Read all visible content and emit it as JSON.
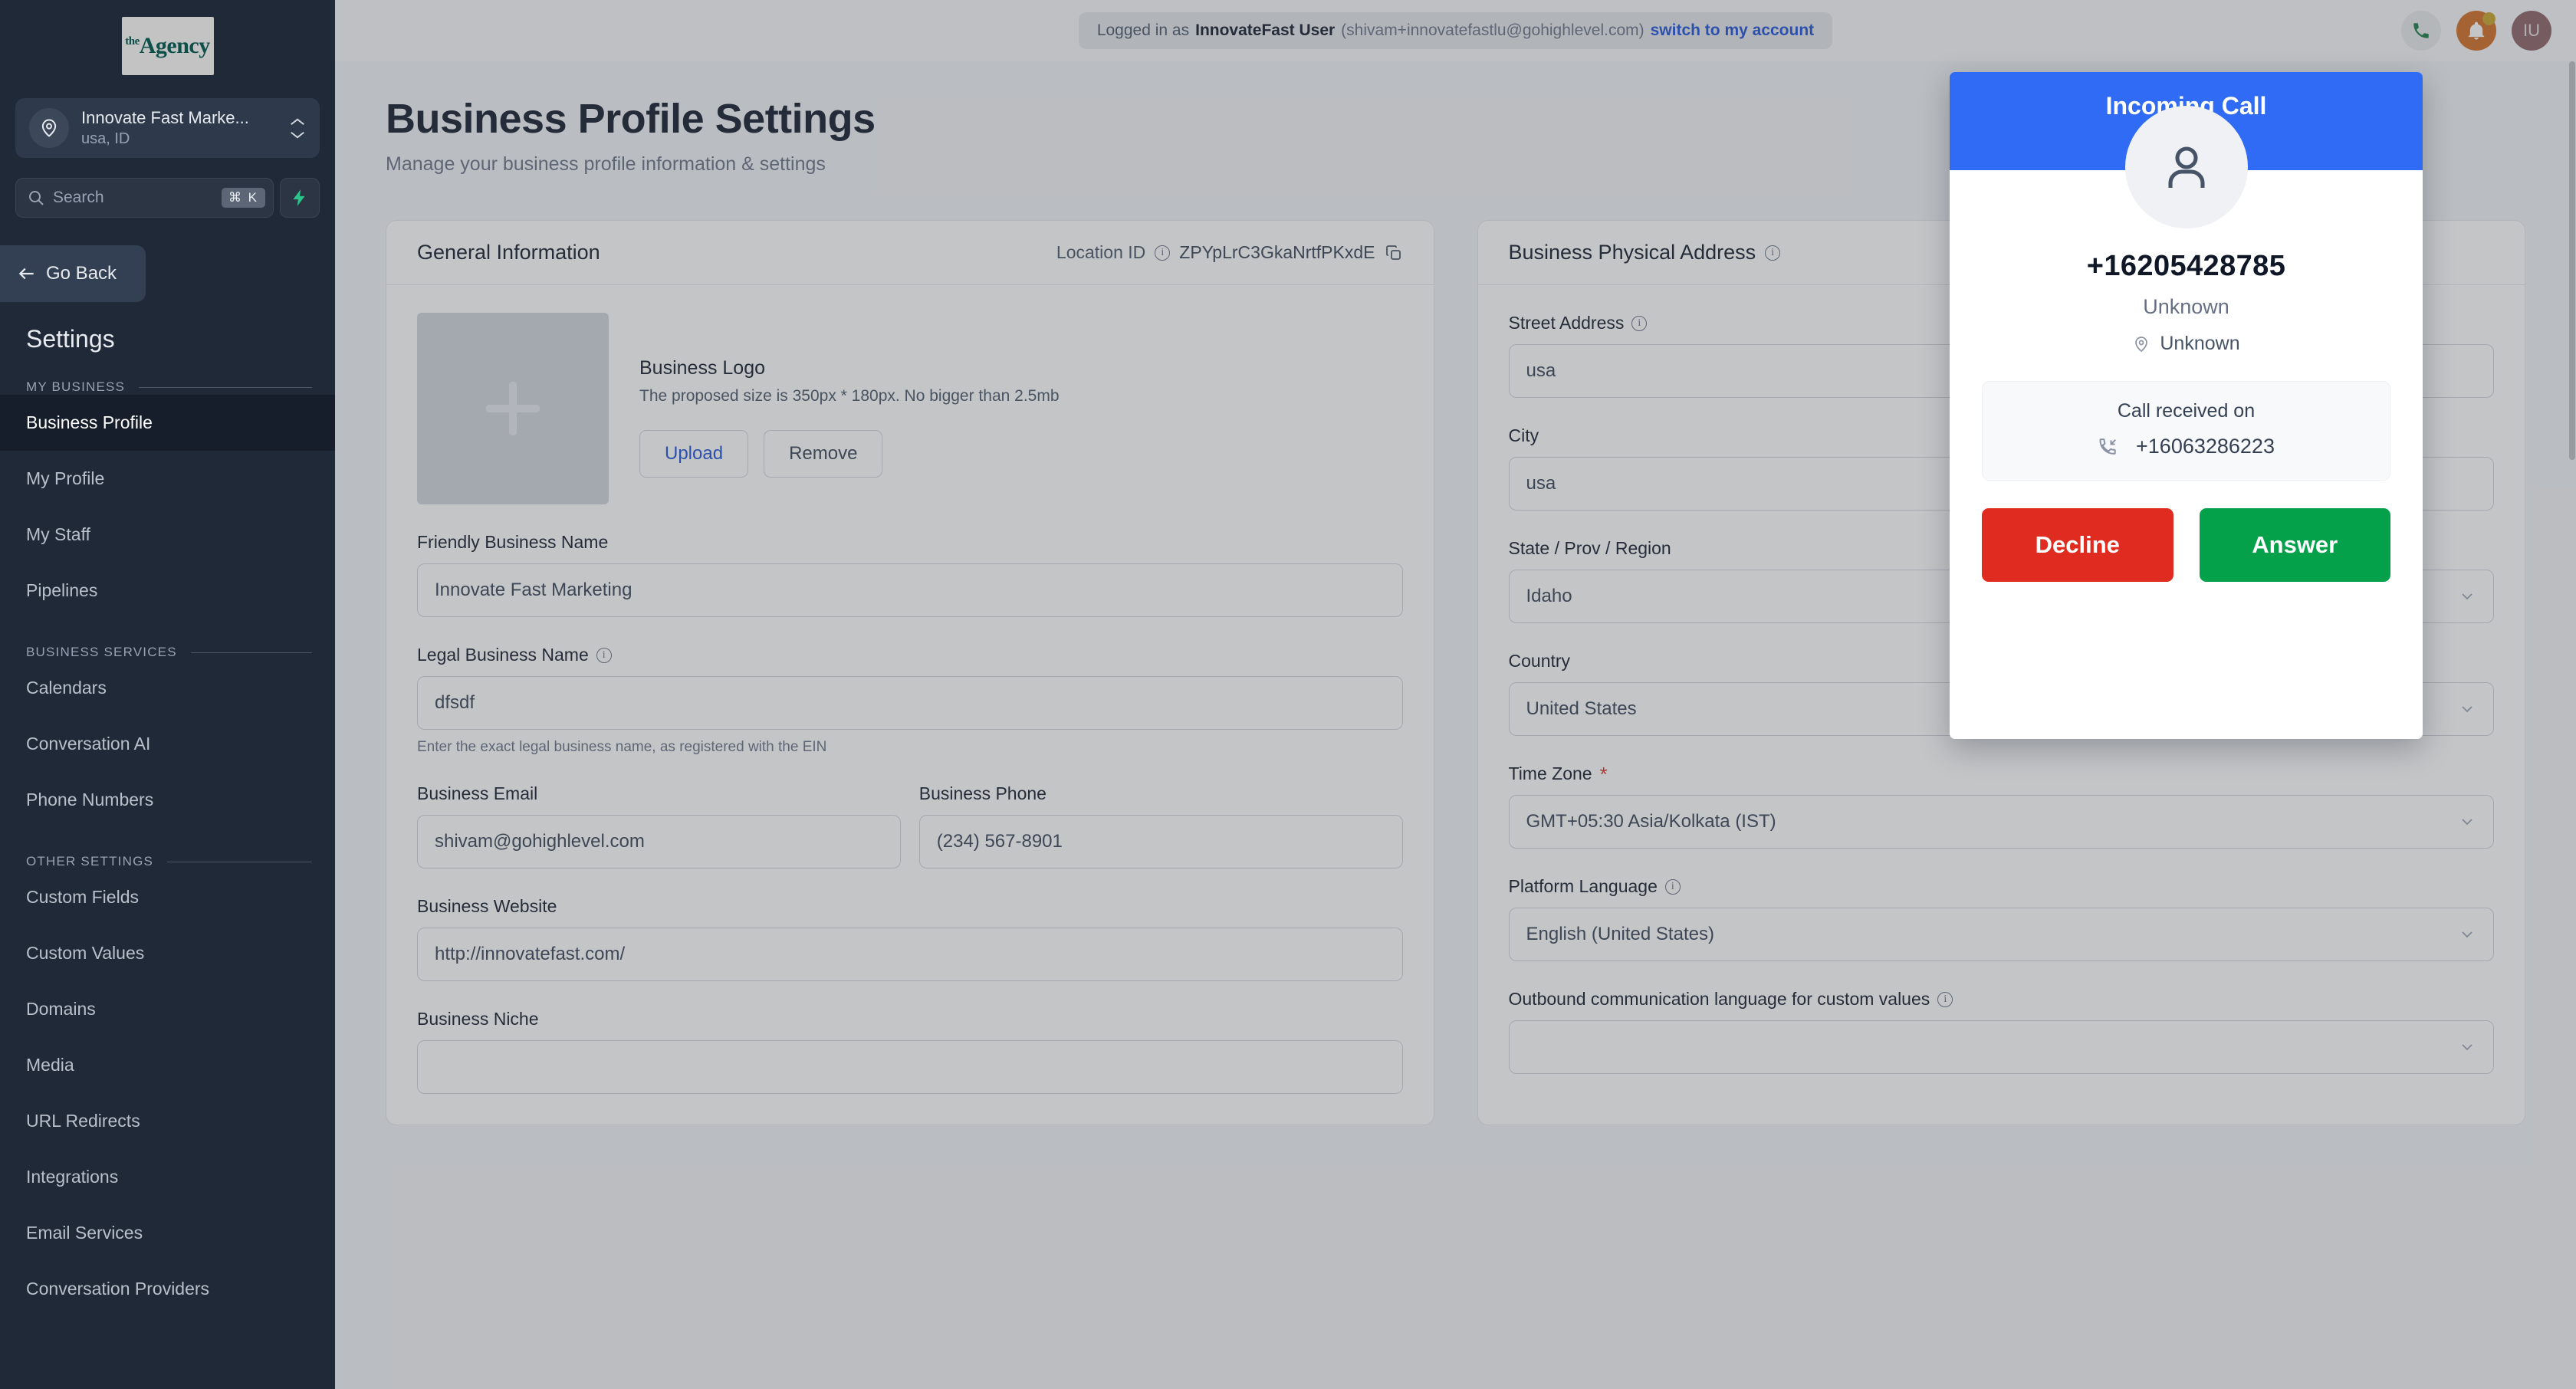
{
  "sidebar": {
    "logo": {
      "sup": "the",
      "name": "Agency"
    },
    "location": {
      "name": "Innovate Fast Marke...",
      "sub": "usa, ID"
    },
    "search": {
      "placeholder": "Search",
      "shortcut": "⌘ K"
    },
    "go_back": "Go Back",
    "title": "Settings",
    "sections": [
      {
        "label": "MY BUSINESS",
        "items": [
          {
            "label": "Business Profile",
            "active": true
          },
          {
            "label": "My Profile",
            "active": false
          },
          {
            "label": "My Staff",
            "active": false
          },
          {
            "label": "Pipelines",
            "active": false
          }
        ]
      },
      {
        "label": "BUSINESS SERVICES",
        "items": [
          {
            "label": "Calendars",
            "active": false
          },
          {
            "label": "Conversation AI",
            "active": false
          },
          {
            "label": "Phone Numbers",
            "active": false
          }
        ]
      },
      {
        "label": "OTHER SETTINGS",
        "items": [
          {
            "label": "Custom Fields",
            "active": false
          },
          {
            "label": "Custom Values",
            "active": false
          },
          {
            "label": "Domains",
            "active": false
          },
          {
            "label": "Media",
            "active": false
          },
          {
            "label": "URL Redirects",
            "active": false
          },
          {
            "label": "Integrations",
            "active": false
          },
          {
            "label": "Email Services",
            "active": false
          },
          {
            "label": "Conversation Providers",
            "active": false
          }
        ]
      }
    ]
  },
  "topbar": {
    "logged_in_prefix": "Logged in as",
    "user_name": "InnovateFast User",
    "user_email": "(shivam+innovatefastlu@gohighlevel.com)",
    "switch_link": "switch to my account",
    "avatar_initials": "IU"
  },
  "page": {
    "title": "Business Profile Settings",
    "subtitle": "Manage your business profile information & settings"
  },
  "general_information": {
    "card_title": "General Information",
    "location_id_label": "Location ID",
    "location_id_value": "ZPYpLrC3GkaNrtfPKxdE",
    "logo": {
      "heading": "Business Logo",
      "hint": "The proposed size is 350px * 180px. No bigger than 2.5mb",
      "upload_label": "Upload",
      "remove_label": "Remove"
    },
    "fields": {
      "friendly_business_name": {
        "label": "Friendly Business Name",
        "value": "Innovate Fast Marketing"
      },
      "legal_business_name": {
        "label": "Legal Business Name",
        "value": "dfsdf",
        "help": "Enter the exact legal business name, as registered with the EIN"
      },
      "business_email": {
        "label": "Business Email",
        "value": "shivam@gohighlevel.com"
      },
      "business_phone": {
        "label": "Business Phone",
        "value": "(234) 567-8901"
      },
      "business_website": {
        "label": "Business Website",
        "value": "http://innovatefast.com/"
      },
      "business_niche": {
        "label": "Business Niche",
        "value": ""
      }
    }
  },
  "business_physical_address": {
    "card_title": "Business Physical Address",
    "fields": {
      "street_address": {
        "label": "Street Address",
        "value": "usa"
      },
      "city": {
        "label": "City",
        "value": "usa"
      },
      "state": {
        "label": "State / Prov / Region",
        "value": "Idaho"
      },
      "country": {
        "label": "Country",
        "value": "United States"
      },
      "time_zone": {
        "label": "Time Zone",
        "value": "GMT+05:30 Asia/Kolkata (IST)",
        "required": true
      },
      "platform_language": {
        "label": "Platform Language",
        "value": "English (United States)"
      },
      "outbound_language": {
        "label": "Outbound communication language for custom values",
        "value": ""
      }
    }
  },
  "call_modal": {
    "banner_title": "Incoming Call",
    "caller_number": "+16205428785",
    "caller_name": "Unknown",
    "caller_location": "Unknown",
    "received_on_label": "Call received on",
    "received_on_number": "+16063286223",
    "decline_label": "Decline",
    "answer_label": "Answer"
  },
  "colors": {
    "accent_blue": "#2f6bf5",
    "link_blue": "#1d4ed8",
    "decline_red": "#e02b20",
    "answer_green": "#04a04a",
    "sidebar_bg": "#1f2937",
    "bell_orange": "#d2691e"
  }
}
